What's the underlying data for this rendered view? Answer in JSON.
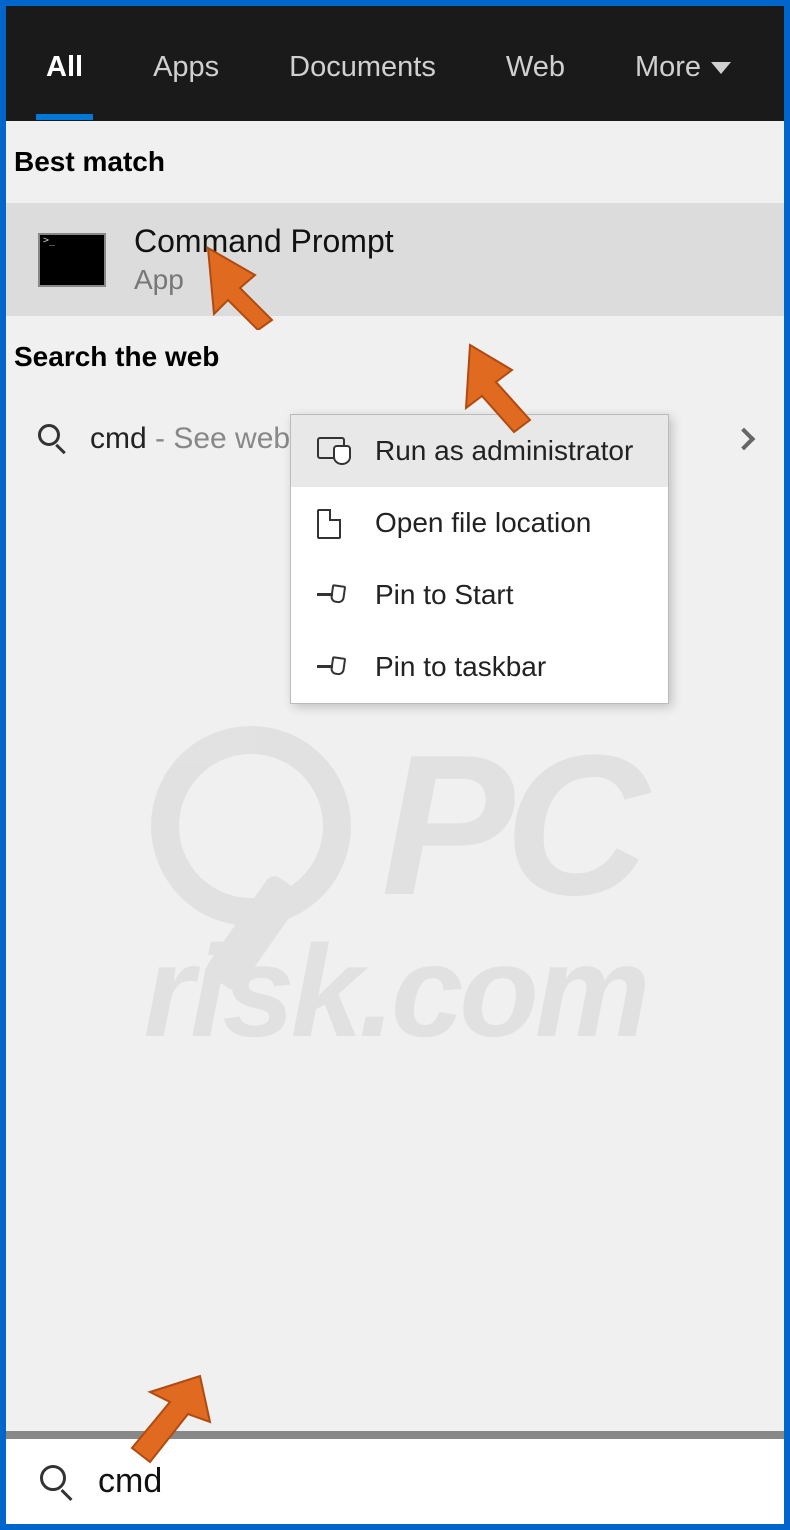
{
  "tabs": {
    "items": [
      "All",
      "Apps",
      "Documents",
      "Web",
      "More"
    ],
    "active_index": 0
  },
  "sections": {
    "best_match": "Best match",
    "search_web": "Search the web"
  },
  "best_match_result": {
    "title": "Command Prompt",
    "subtitle": "App"
  },
  "web_result": {
    "query": "cmd",
    "suffix": " - See web"
  },
  "context_menu": {
    "items": [
      {
        "label": "Run as administrator",
        "icon": "admin-shield-icon"
      },
      {
        "label": "Open file location",
        "icon": "folder-icon"
      },
      {
        "label": "Pin to Start",
        "icon": "pin-icon"
      },
      {
        "label": "Pin to taskbar",
        "icon": "pin-icon"
      }
    ],
    "hovered_index": 0
  },
  "search": {
    "value": "cmd"
  },
  "watermark": {
    "brand_top": "PC",
    "brand_bottom": "risk.com"
  },
  "colors": {
    "accent": "#0078d7",
    "window_border": "#0066cc",
    "annotation_arrow": "#e06a1f"
  }
}
